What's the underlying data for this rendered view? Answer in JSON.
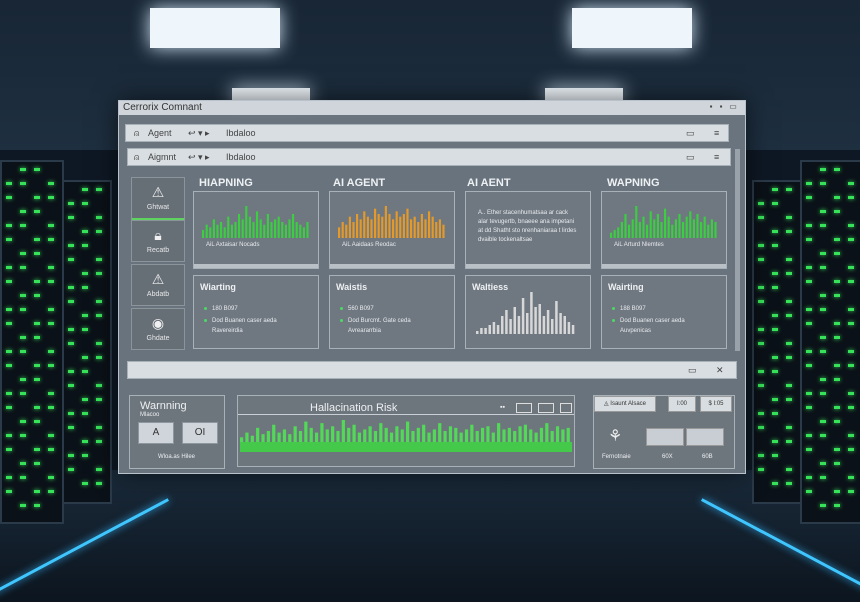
{
  "window": {
    "title": "Cerrorix Comnant",
    "controls": [
      "min-icon",
      "max-icon",
      "restore-icon"
    ]
  },
  "toolbar1": {
    "label": "Agent",
    "nav": "↩ ▾ ▸",
    "crumb": "Ibdaloo"
  },
  "toolbar2": {
    "label": "Aigmnt",
    "nav": "↩ ▾ ▸",
    "crumb": "Ibdaloo"
  },
  "sidebar": {
    "items": [
      {
        "icon": "warning-icon",
        "label": "Ghtwat"
      },
      {
        "icon": "lock-icon",
        "label": "Recatb"
      },
      {
        "icon": "warning-icon",
        "label": "Abdatb"
      },
      {
        "icon": "location-icon",
        "label": "Ghdate"
      }
    ]
  },
  "top_cards": [
    {
      "title": "HIAPNING",
      "caption": "AiL Axtaisar Nocads",
      "color": "#3ccd43"
    },
    {
      "title": "AI AGENT",
      "caption": "AiL Aaidaas Reodac",
      "color": "#e39a2a"
    },
    {
      "title": "AI AENT",
      "caption": [
        "A.. Ether stacenhumatsaa ar cack",
        "alar tevugertb, bnaeee ana impetani",
        "at dd Shatht sto nrenhaniaraa t lirdes",
        "dvaible tockenaltsae"
      ],
      "color": "#cccccc"
    },
    {
      "title": "WAPNING",
      "caption": "AiL Arturd Nlemtes",
      "color": "#3ccd43"
    }
  ],
  "mid_cards": [
    {
      "title": "Wiarting",
      "l1": "180 B097",
      "l2": "Dod Buanen caser aeda",
      "l3": "Ravereirdia"
    },
    {
      "title": "Waistis",
      "l1": "560 B097",
      "l2": "Dod Burcmt. Gate ceda",
      "l3": "Avreararrbia"
    },
    {
      "title": "Waltiess",
      "l1": "",
      "l2": "",
      "l3": ""
    },
    {
      "title": "Wairting",
      "l1": "188 B097",
      "l2": "Dod Buanen caser aeda",
      "l3": "Auvpenicas"
    }
  ],
  "bottom_left": {
    "title": "Warnning",
    "sub": "Mlacoo",
    "btn1": "A",
    "btn2": "OI",
    "footer": "Wloa.as Hilee"
  },
  "risk": {
    "title": "Hallacination Risk"
  },
  "bottom_right": {
    "tab1": "Isaunt Alsace",
    "tab2": "I:00",
    "tab3": "$ I:05",
    "label": "Fernotnaie",
    "v1": "60X",
    "v2": "60B"
  },
  "chart_data": {
    "type": "bar",
    "series": [
      {
        "name": "HIAPNING",
        "values": [
          3,
          5,
          4,
          7,
          5,
          6,
          4,
          8,
          5,
          6,
          9,
          7,
          12,
          8,
          6,
          10,
          7,
          5,
          9,
          6,
          7,
          8,
          6,
          5,
          7,
          9,
          6,
          5,
          4,
          6
        ]
      },
      {
        "name": "AI AGENT",
        "values": [
          4,
          6,
          5,
          8,
          6,
          9,
          7,
          10,
          8,
          7,
          11,
          9,
          8,
          12,
          9,
          7,
          10,
          8,
          9,
          11,
          7,
          8,
          6,
          9,
          7,
          10,
          8,
          6,
          7,
          5
        ]
      },
      {
        "name": "WAPNING",
        "values": [
          2,
          3,
          4,
          6,
          9,
          5,
          7,
          12,
          6,
          8,
          5,
          10,
          7,
          9,
          6,
          11,
          8,
          5,
          7,
          9,
          6,
          8,
          10,
          7,
          9,
          6,
          8,
          5,
          7,
          6
        ]
      },
      {
        "name": "Waltiess",
        "values": [
          1,
          2,
          2,
          3,
          4,
          3,
          6,
          8,
          5,
          9,
          6,
          12,
          7,
          14,
          9,
          10,
          6,
          8,
          5,
          11,
          7,
          6,
          4,
          3
        ]
      },
      {
        "name": "Hallacination Risk",
        "values": [
          3,
          6,
          4,
          9,
          5,
          7,
          11,
          6,
          8,
          5,
          10,
          7,
          13,
          9,
          6,
          12,
          8,
          10,
          7,
          14,
          9,
          11,
          6,
          8,
          10,
          7,
          12,
          9,
          6,
          10,
          8,
          13,
          7,
          9,
          11,
          6,
          8,
          12,
          7,
          10,
          9,
          6,
          8,
          11,
          7,
          9,
          10,
          6,
          12,
          8,
          9,
          7,
          10,
          11,
          8,
          6,
          9,
          12,
          7,
          10,
          8,
          9
        ]
      }
    ]
  }
}
